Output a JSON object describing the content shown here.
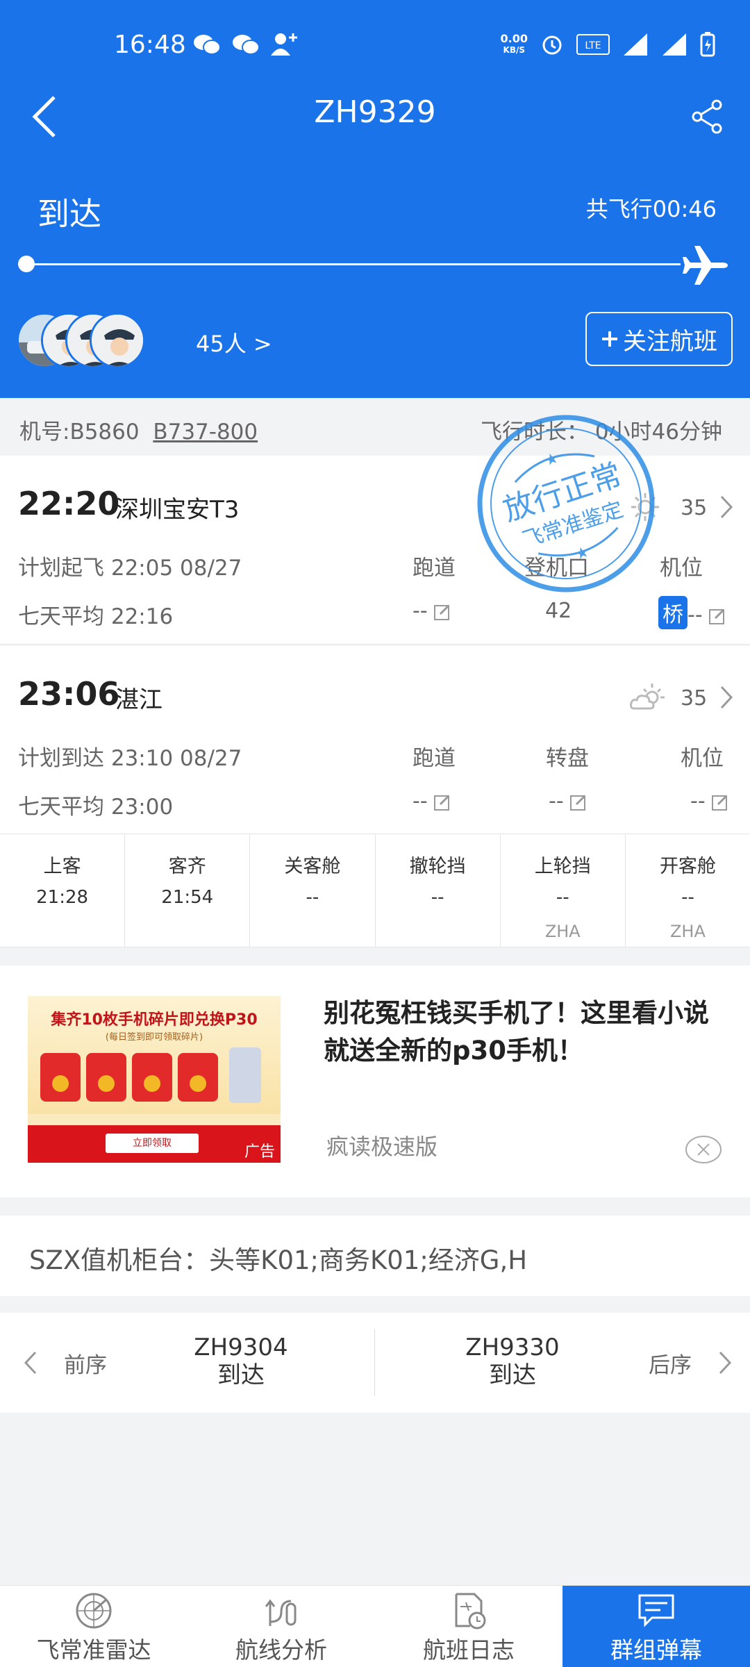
{
  "status_bar": {
    "time": "16:48",
    "speed_value": "0.00",
    "speed_unit": "KB/S"
  },
  "header": {
    "title": "ZH9329",
    "status": "到达",
    "duration": "共飞行00:46",
    "followers": "45人 >",
    "follow_button": "关注航班",
    "progress": 1.0
  },
  "aircraft": {
    "reg": "机号:B5860",
    "type": "B737-800",
    "flight_time": "飞行时长： 0小时46分钟"
  },
  "departure": {
    "time": "22:20",
    "airport": "深圳宝安T3",
    "temp": "35",
    "planned": "计划起飞 22:05 08/27",
    "avg": "七天平均 22:16",
    "h_runway": "跑道",
    "h_gate": "登机口",
    "h_stand": "机位",
    "runway": "--",
    "gate": "42",
    "stand_badge": "桥",
    "stand": "--"
  },
  "stamp": {
    "line1": "放行正常",
    "line2": "飞常准鉴定"
  },
  "arrival": {
    "time": "23:06",
    "airport": "湛江",
    "temp": "35",
    "planned": "计划到达 23:10 08/27",
    "avg": "七天平均 23:00",
    "h_runway": "跑道",
    "h_carousel": "转盘",
    "h_stand": "机位",
    "runway": "--",
    "carousel": "--",
    "stand": "--"
  },
  "boarding": [
    {
      "label": "上客",
      "value": "21:28",
      "code": ""
    },
    {
      "label": "客齐",
      "value": "21:54",
      "code": ""
    },
    {
      "label": "关客舱",
      "value": "--",
      "code": ""
    },
    {
      "label": "撤轮挡",
      "value": "--",
      "code": ""
    },
    {
      "label": "上轮挡",
      "value": "--",
      "code": "ZHA"
    },
    {
      "label": "开客舱",
      "value": "--",
      "code": "ZHA"
    }
  ],
  "ad": {
    "image_title": "集齐10枚手机碎片即兑换P30",
    "image_sub": "(每日签到即可领取碎片)",
    "image_button": "立即领取",
    "image_tag": "广告",
    "title": "别花冤枉钱买手机了！这里看小说就送全新的p30手机！",
    "source": "疯读极速版"
  },
  "checkin_counter": "SZX值机柜台：头等K01;商务K01;经济G,H",
  "flight_nav": {
    "prev_label": "前序",
    "prev_flight": "ZH9304",
    "prev_status": "到达",
    "next_label": "后序",
    "next_flight": "ZH9330",
    "next_status": "到达"
  },
  "tabs": [
    {
      "label": "飞常准雷达",
      "icon": "radar-icon"
    },
    {
      "label": "航线分析",
      "icon": "route-analysis-icon"
    },
    {
      "label": "航班日志",
      "icon": "flight-log-icon"
    },
    {
      "label": "群组弹幕",
      "icon": "group-chat-icon",
      "active": true
    }
  ],
  "colors": {
    "primary": "#1a73e8",
    "stamp": "#2f8ee6"
  }
}
